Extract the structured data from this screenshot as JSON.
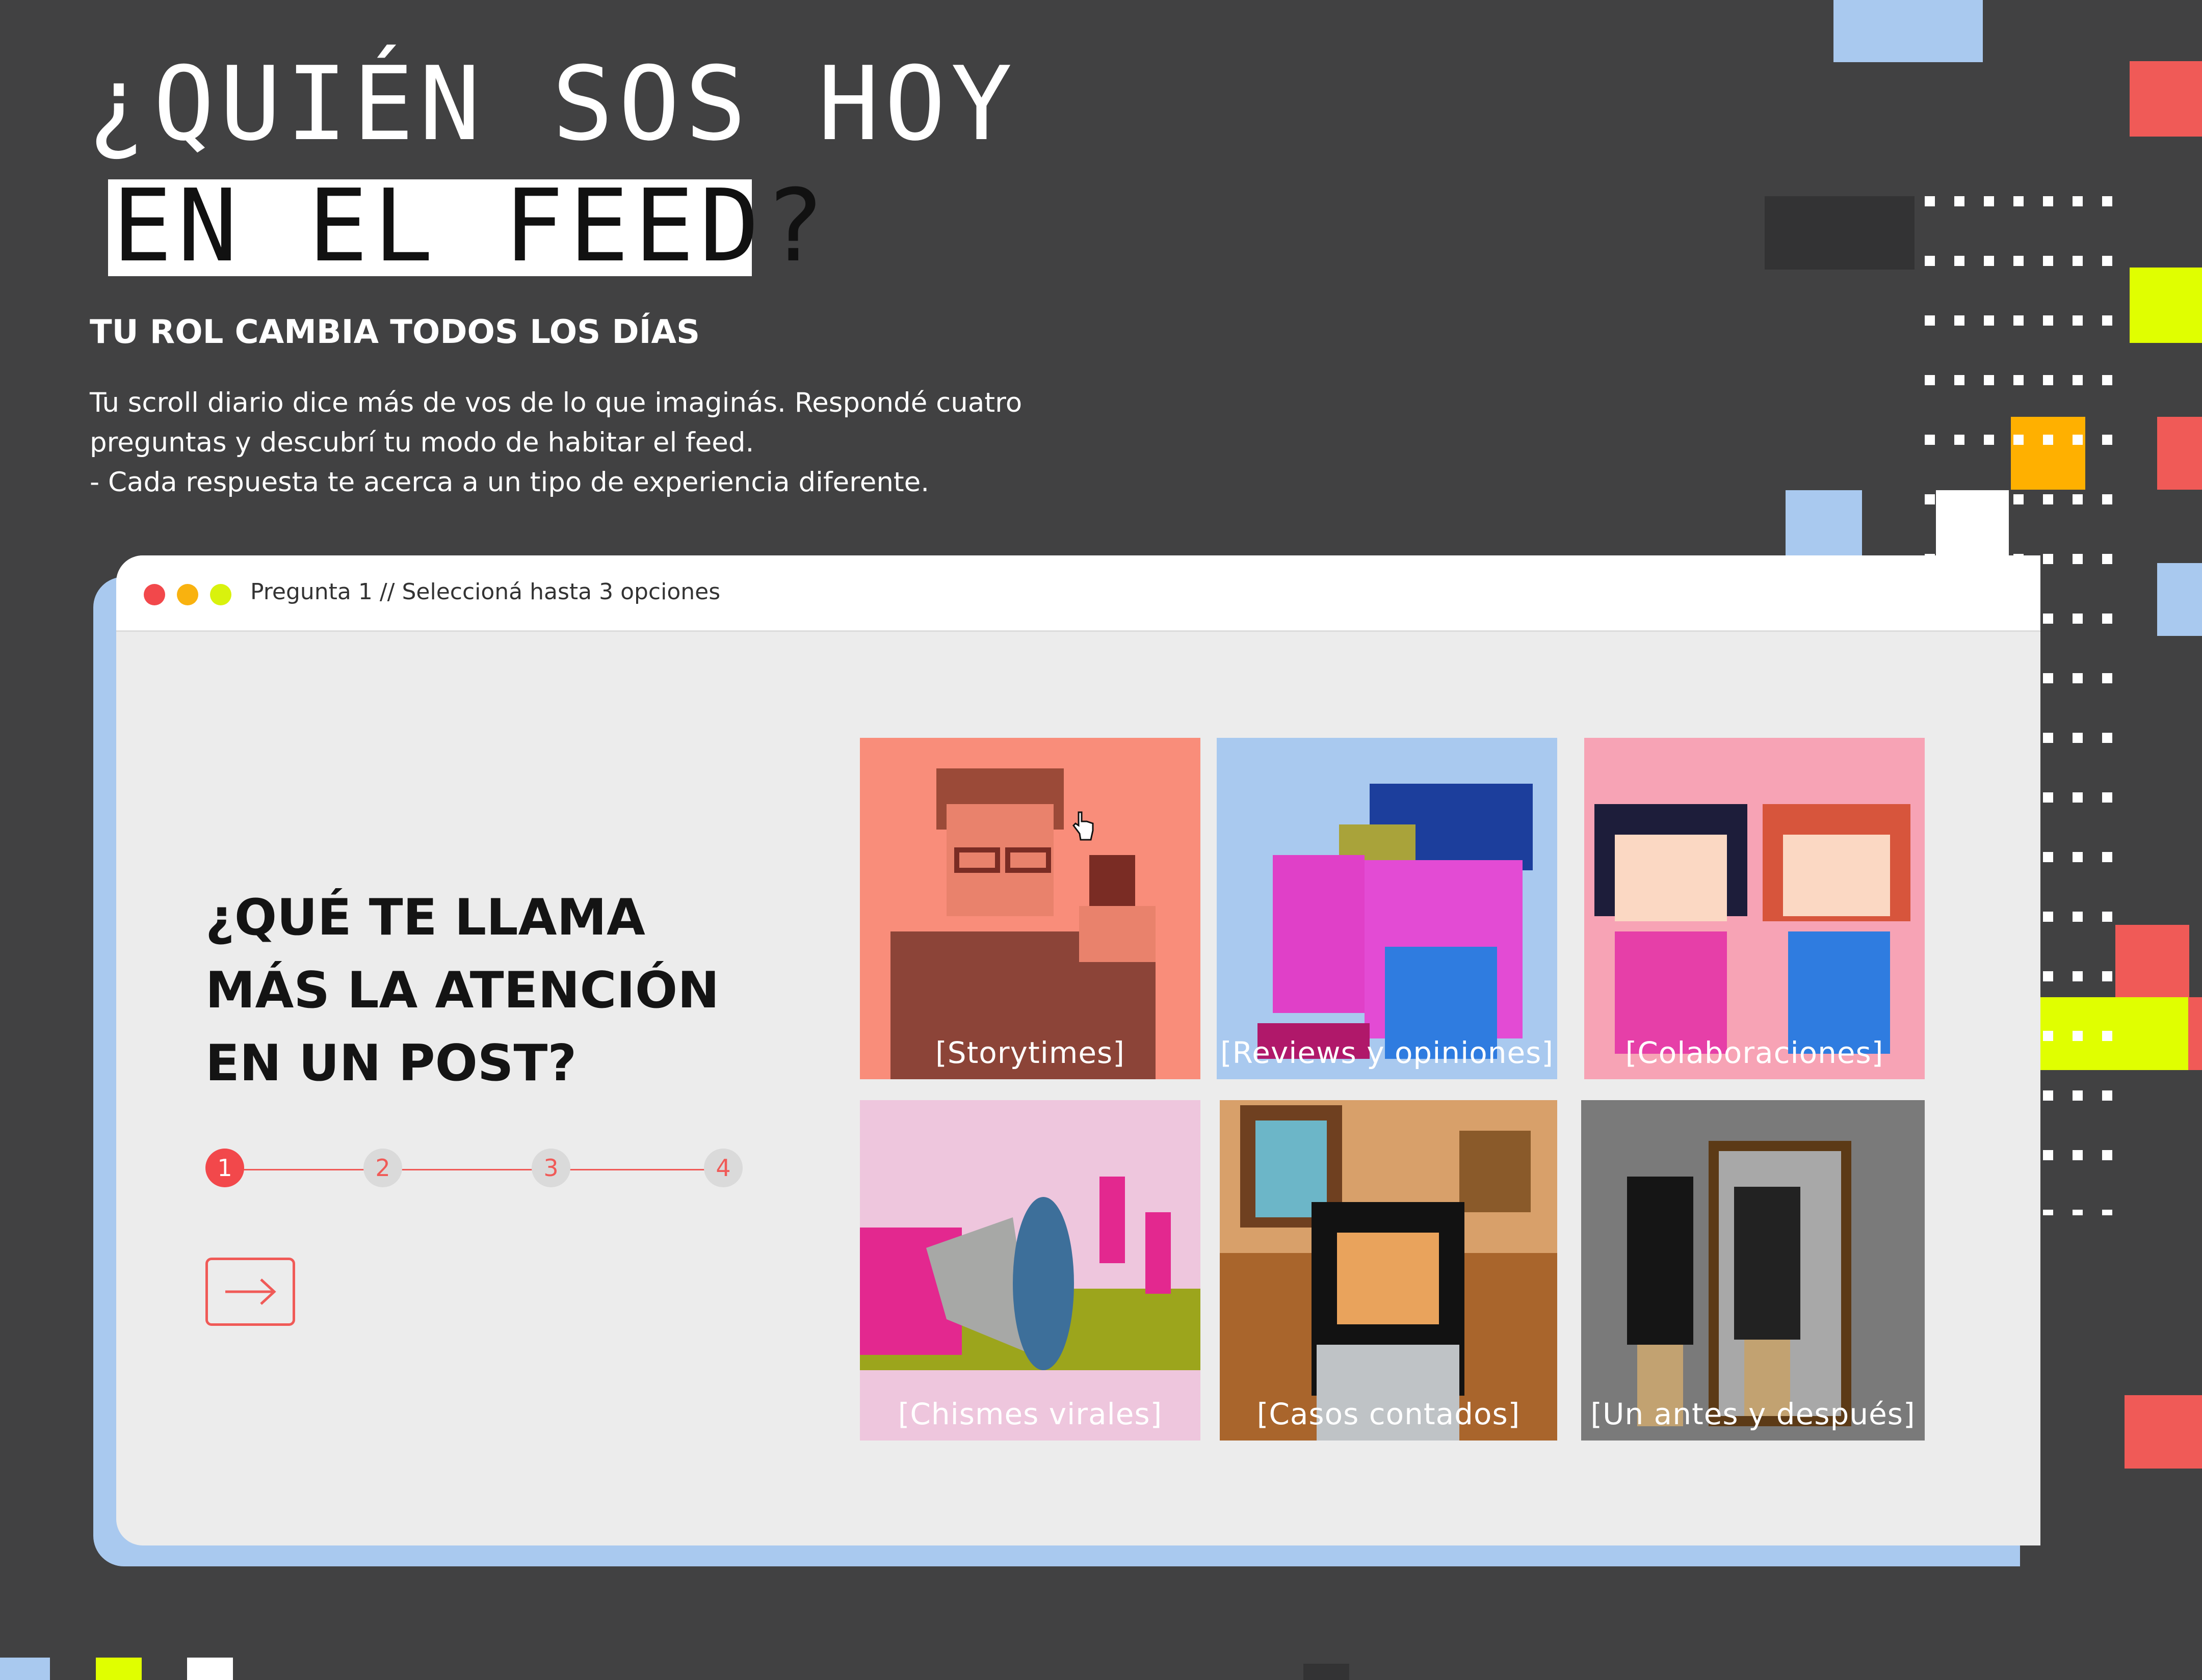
{
  "hero": {
    "title_line1": "¿QUIÉN SOS HOY",
    "title_line2": "EN EL FEED?",
    "subtitle": "TU ROL CAMBIA TODOS LOS DÍAS",
    "intro_lines": [
      "Tu scroll diario dice más de vos de lo que imaginás. Respondé cuatro",
      "preguntas y descubrí tu modo de habitar el feed.",
      "- Cada respuesta te acerca a un tipo de experiencia diferente."
    ]
  },
  "window": {
    "titlebar_text": "Pregunta 1  //  Seleccioná hasta 3 opciones",
    "controls": [
      {
        "name": "close",
        "color": "#f2484b"
      },
      {
        "name": "minimize",
        "color": "#f9b20f"
      },
      {
        "name": "maximize",
        "color": "#d9f20d"
      }
    ]
  },
  "quiz": {
    "question_lines": [
      "¿QUÉ TE LLAMA",
      "MÁS LA ATENCIÓN",
      "EN UN POST?"
    ],
    "current_step": 1,
    "steps": [
      "1",
      "2",
      "3",
      "4"
    ],
    "next_icon": "arrow-right-icon",
    "options": [
      {
        "label": "[Storytimes]",
        "bg": "#f98d7a"
      },
      {
        "label": "[Reviews y opiniones]",
        "bg": "#a9c9ef"
      },
      {
        "label": "[Colaboraciones]",
        "bg": "#f7a3b5"
      },
      {
        "label": "[Chismes virales]",
        "bg": "#eec6dd"
      },
      {
        "label": "[Casos contados]",
        "bg": "#d8a06a"
      },
      {
        "label": "[Un antes y después]",
        "bg": "#7a7a7a"
      }
    ]
  },
  "colors": {
    "background": "#414142",
    "accent_red": "#f05a57",
    "accent_blue": "#a9c9ef",
    "accent_lime": "#e0ff00",
    "accent_orange": "#ffb000"
  }
}
